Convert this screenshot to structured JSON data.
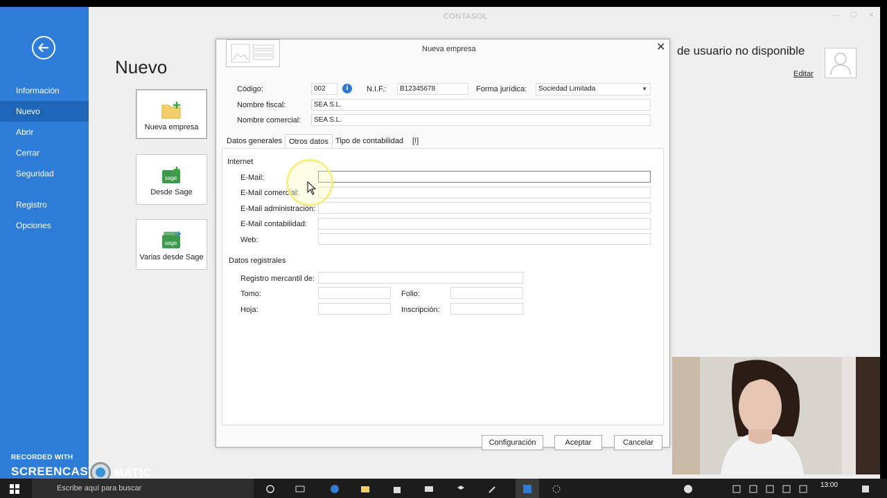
{
  "app": {
    "title": "CONTASOL"
  },
  "backstage": {
    "menu": [
      "Información",
      "Nuevo",
      "Abrir",
      "Cerrar",
      "Seguridad",
      "Registro",
      "Opciones"
    ],
    "page_title": "Nuevo",
    "tiles": [
      "Nueva empresa",
      "Desde Sage",
      "Varias desde Sage"
    ],
    "user_text": "de usuario no disponible",
    "edit_link": "Editar"
  },
  "watermark": {
    "line1": "RECORDED WITH",
    "line2a": "SCREENCAST",
    "line2b": "MATIC"
  },
  "dialog": {
    "title": "Nueva empresa",
    "close": "✕",
    "codigo_label": "Código:",
    "codigo_value": "002",
    "nif_label": "N.I.F.:",
    "nif_value": "B12345678",
    "forma_label": "Forma jurídica:",
    "forma_value": "Sociedad Limitada",
    "nombre_fiscal_label": "Nombre fiscal:",
    "nombre_fiscal_value": "SEA S.L.",
    "nombre_comercial_label": "Nombre comercial:",
    "nombre_comercial_value": "SEA S.L.",
    "tabs": [
      "Datos generales",
      "Otros datos",
      "Tipo de contabilidad",
      "[!]"
    ],
    "internet": {
      "section": "Internet",
      "email": "E-Mail:",
      "email_comercial": "E-Mail comercial:",
      "email_admin": "E-Mail administración:",
      "email_contab": "E-Mail contabilidad:",
      "web": "Web:"
    },
    "registrales": {
      "section": "Datos registrales",
      "registro": "Registro mercantil de:",
      "tomo": "Tomo:",
      "folio": "Folio:",
      "hoja": "Hoja:",
      "inscripcion": "Inscripción:"
    },
    "buttons": {
      "config": "Configuración",
      "accept": "Aceptar",
      "cancel": "Cancelar"
    }
  },
  "taskbar": {
    "search_placeholder": "Escribe aquí para buscar",
    "time": "13:00"
  }
}
